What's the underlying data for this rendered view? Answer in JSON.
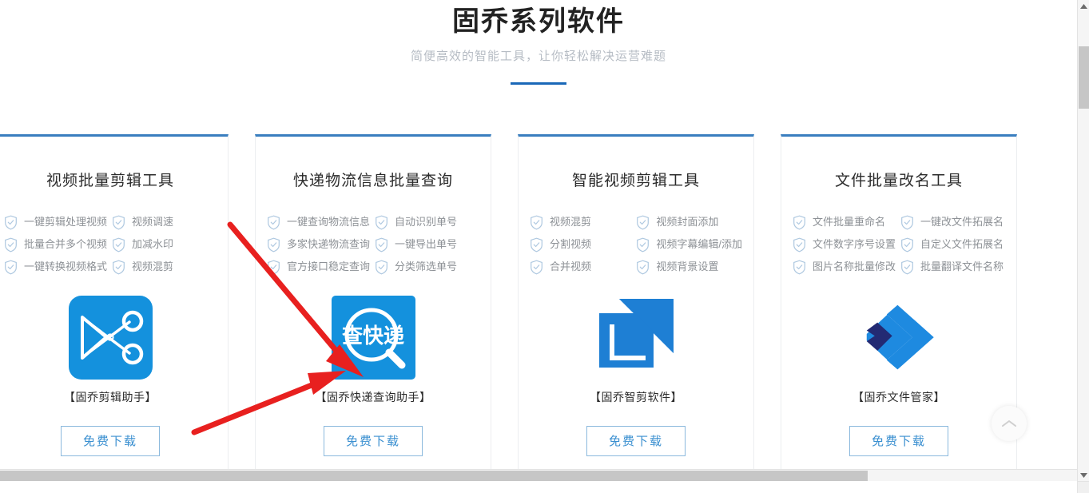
{
  "header": {
    "title": "固乔系列软件",
    "subtitle": "简便高效的智能工具，让你轻松解决运营难题"
  },
  "cards": [
    {
      "title": "视频批量剪辑工具",
      "features": [
        "一键剪辑处理视频",
        "视频调速",
        "批量合并多个视频",
        "加减水印",
        "一键转换视频格式",
        "视频混剪"
      ],
      "icon_name": "scissors-app-icon",
      "product_name": "【固乔剪辑助手】",
      "download_label": "免费下载"
    },
    {
      "title": "快递物流信息批量查询",
      "features": [
        "一键查询物流信息",
        "自动识别单号",
        "多家快递物流查询",
        "一键导出单号",
        "官方接口稳定查询",
        "分类筛选单号"
      ],
      "icon_name": "express-query-app-icon",
      "icon_text": "查快递",
      "product_name": "【固乔快递查询助手】",
      "download_label": "免费下载"
    },
    {
      "title": "智能视频剪辑工具",
      "features": [
        "视频混剪",
        "视频封面添加",
        "分割视频",
        "视频字幕编辑/添加",
        "合并视频",
        "视频背景设置"
      ],
      "icon_name": "smart-clip-app-icon",
      "product_name": "【固乔智剪软件】",
      "download_label": "免费下载"
    },
    {
      "title": "文件批量改名工具",
      "features": [
        "文件批量重命名",
        "一键改文件拓展名",
        "文件数字序号设置",
        "自定义文件拓展名",
        "图片名称批量修改",
        "批量翻译文件名称"
      ],
      "icon_name": "file-manager-app-icon",
      "product_name": "【固乔文件管家】",
      "download_label": "免费下载"
    }
  ],
  "colors": {
    "accent": "#1a68b8",
    "card_top_border": "#3a7ebf",
    "app_blue": "#1491dd",
    "annotation_red": "#e8201f",
    "button_text": "#3a8fd0"
  },
  "icons": {
    "back_to_top": "chevron-up-icon",
    "feature_bullet": "shield-check-icon"
  }
}
